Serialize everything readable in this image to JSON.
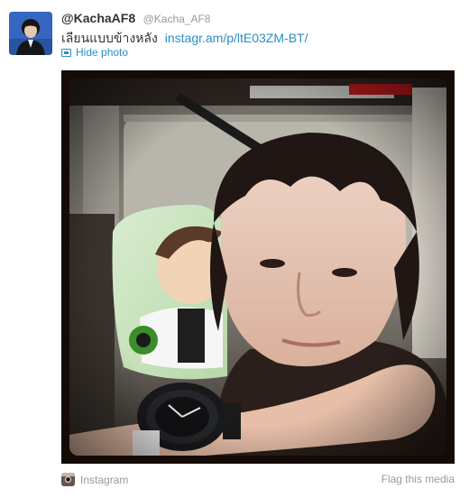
{
  "tweet": {
    "display_name": "@KachaAF8",
    "username": "@Kacha_AF8",
    "text": "เลียนแบบข้างหลัง",
    "link_text": "instagr.am/p/ltE03ZM-BT/",
    "hide_photo_label": "Hide photo"
  },
  "media": {
    "description": "Instagram photo of a young man in a car back seat with a cartoon pillow and wristwatch",
    "source_label": "Instagram",
    "flag_label": "Flag this media"
  },
  "icons": {
    "photo": "photo-icon",
    "instagram": "instagram-icon"
  },
  "colors": {
    "link": "#2a8ec8",
    "muted": "#999999",
    "text": "#333333",
    "frame": "#140b07"
  }
}
